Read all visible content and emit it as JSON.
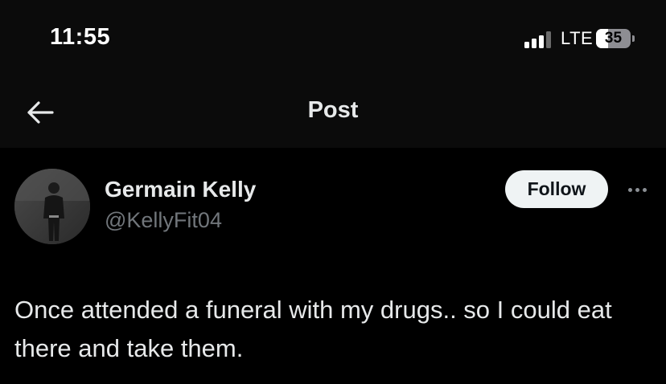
{
  "status_bar": {
    "time": "11:55",
    "network": "LTE",
    "battery": "35",
    "signal_bars_active": 3,
    "signal_bars_total": 4
  },
  "nav": {
    "back_icon": "arrow-left-icon",
    "title": "Post"
  },
  "post": {
    "author_name": "Germain Kelly",
    "author_handle": "@KellyFit04",
    "follow_label": "Follow",
    "more_icon": "ellipsis-icon",
    "text": "Once attended a funeral with my drugs.. so I could eat there and take them."
  },
  "colors": {
    "background": "#000000",
    "header_background": "#0b0b0b",
    "primary_text": "#e7e9ea",
    "secondary_text": "#71767b",
    "follow_bg": "#eff3f4"
  }
}
